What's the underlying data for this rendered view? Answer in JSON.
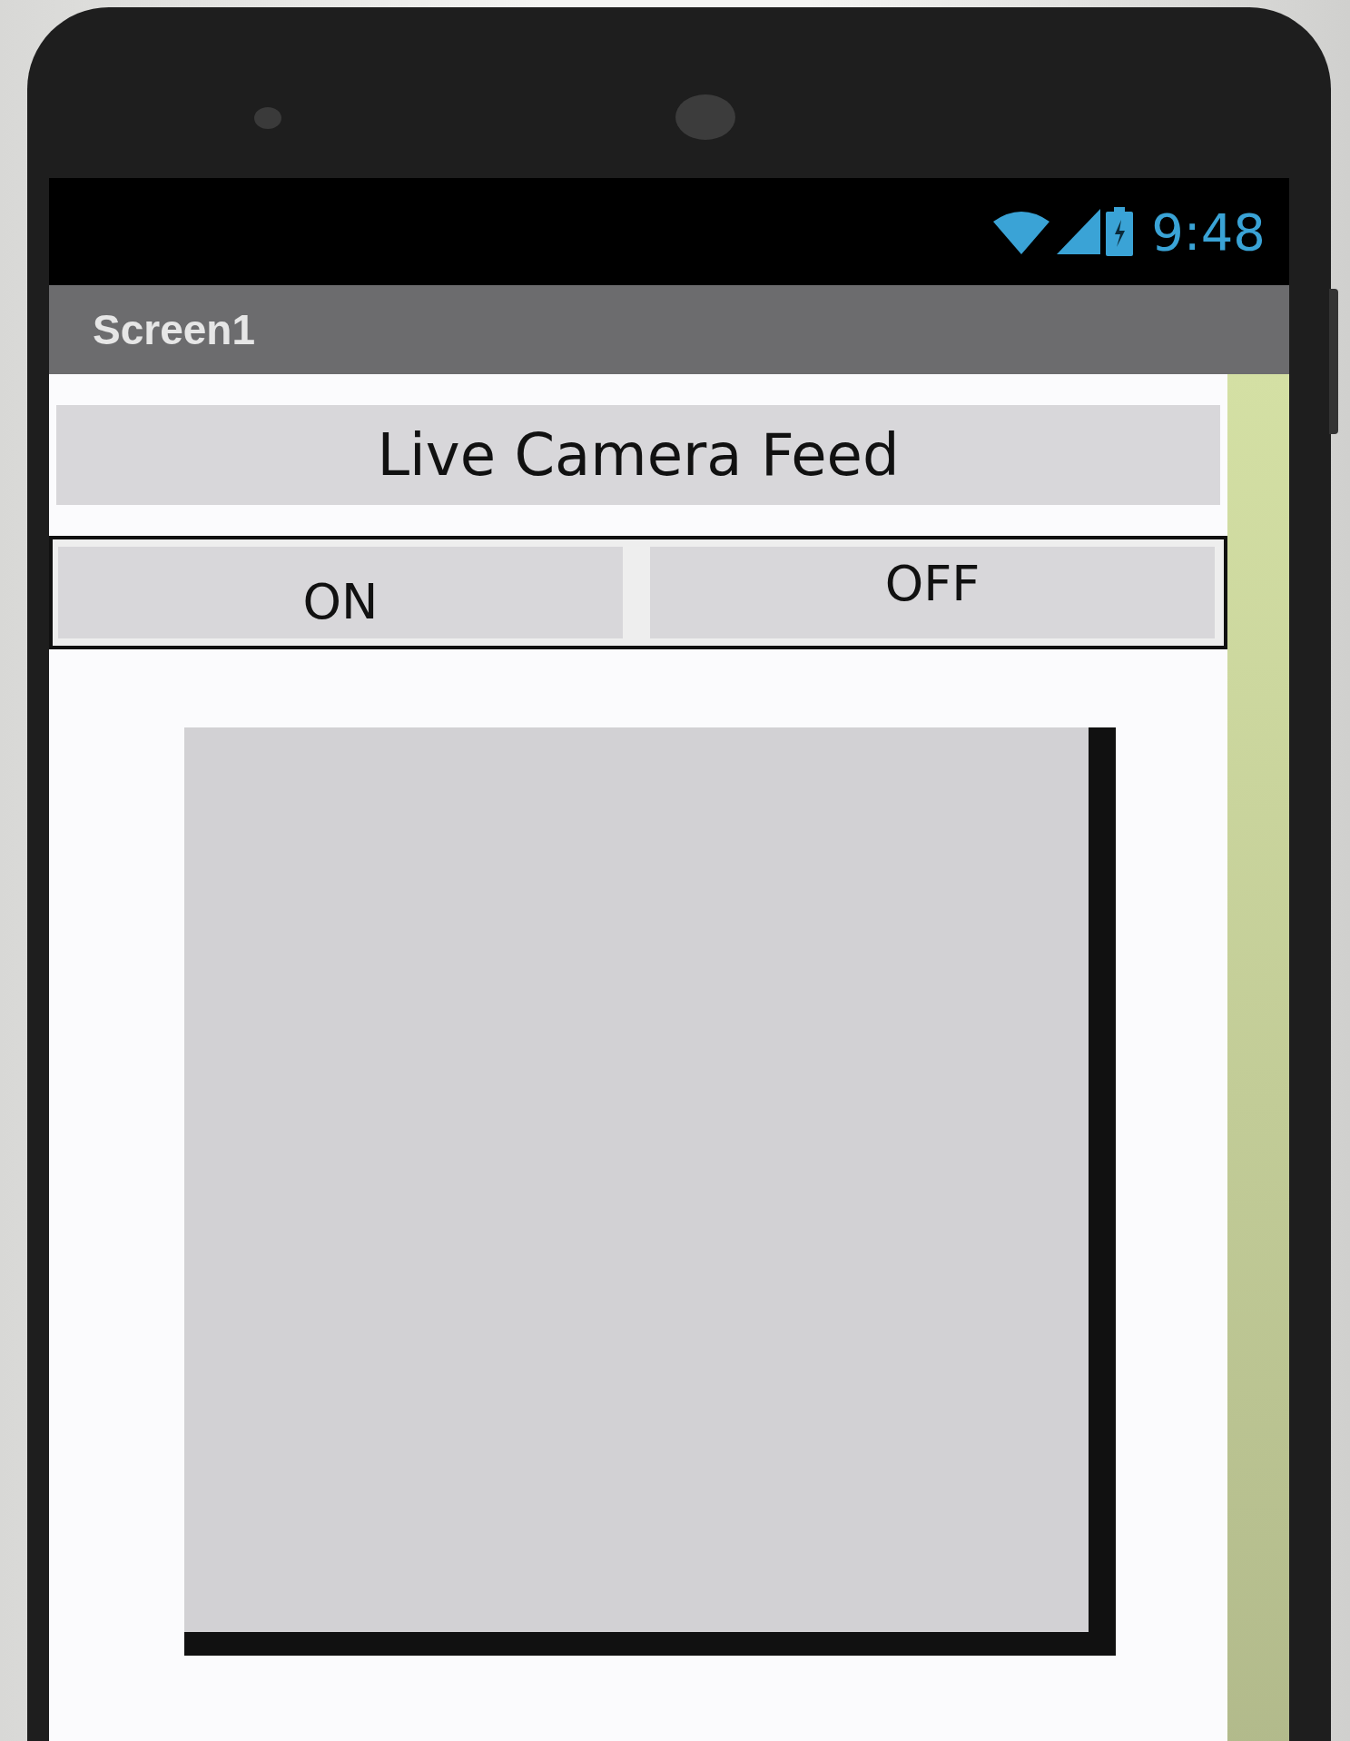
{
  "status_bar": {
    "time": "9:48"
  },
  "title_bar": {
    "title": "Screen1"
  },
  "label": {
    "text": "Live Camera Feed"
  },
  "buttons": [
    "ON",
    "OFF"
  ]
}
